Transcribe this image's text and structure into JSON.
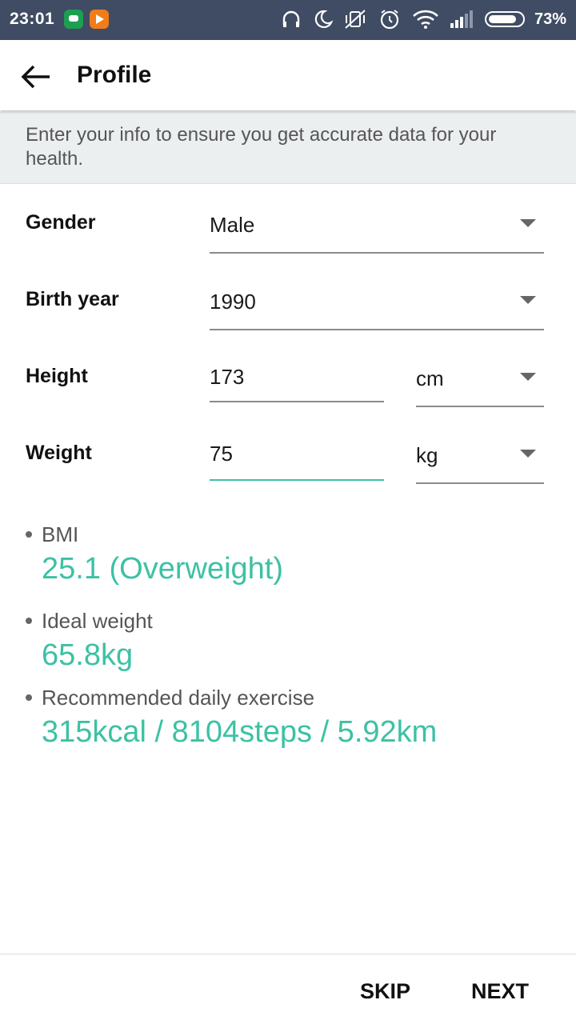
{
  "status_bar": {
    "time": "23:01",
    "battery_percent": "73%",
    "icons": [
      "hangouts-icon",
      "play-music-icon",
      "headphones-icon",
      "moon-icon",
      "vibrate-off-icon",
      "alarm-icon",
      "wifi-icon",
      "signal-icon",
      "battery-icon"
    ]
  },
  "toolbar": {
    "back_icon": "arrow-left-icon",
    "title": "Profile"
  },
  "info": {
    "text": "Enter your info to ensure you get accurate data for your health."
  },
  "form": {
    "gender": {
      "label": "Gender",
      "value": "Male"
    },
    "birth_year": {
      "label": "Birth year",
      "value": "1990"
    },
    "height": {
      "label": "Height",
      "value": "173",
      "unit": "cm"
    },
    "weight": {
      "label": "Weight",
      "value": "75",
      "unit": "kg"
    }
  },
  "results": {
    "bmi": {
      "label": "BMI",
      "value": "25.1 (Overweight)"
    },
    "ideal_weight": {
      "label": "Ideal weight",
      "value": "65.8kg"
    },
    "exercise": {
      "label": "Recommended daily exercise",
      "value": "315kcal / 8104steps / 5.92km"
    }
  },
  "footer": {
    "skip_label": "SKIP",
    "next_label": "NEXT"
  },
  "colors": {
    "status_bar": "#3f4c63",
    "accent": "#3cc1a4",
    "banner": "#eceff0"
  }
}
